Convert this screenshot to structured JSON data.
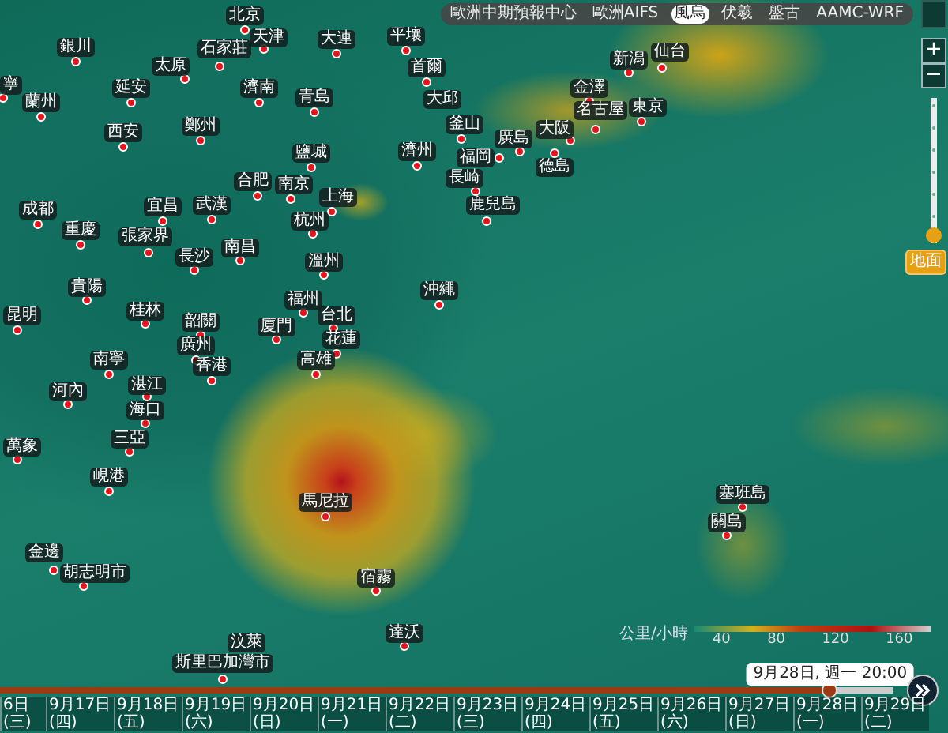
{
  "model_tabs": [
    {
      "label": "歐洲中期預報中心",
      "selected": false
    },
    {
      "label": "歐洲AIFS",
      "selected": false
    },
    {
      "label": "風烏",
      "selected": true
    },
    {
      "label": "伏羲",
      "selected": false
    },
    {
      "label": "盤古",
      "selected": false
    },
    {
      "label": "AAMC-WRF",
      "selected": false
    }
  ],
  "zoom_buttons": [
    "+",
    "−"
  ],
  "altitude": {
    "level": 0,
    "label": "地面"
  },
  "cities": [
    {
      "name": "北京"
    },
    {
      "name": "銀川"
    },
    {
      "name": "太原"
    },
    {
      "name": "石家莊"
    },
    {
      "name": "天津"
    },
    {
      "name": "大連"
    },
    {
      "name": "平壤"
    },
    {
      "name": "首爾"
    },
    {
      "name": "新潟"
    },
    {
      "name": "仙台"
    },
    {
      "name": "寧"
    },
    {
      "name": "蘭州"
    },
    {
      "name": "延安"
    },
    {
      "name": "濟南"
    },
    {
      "name": "青島"
    },
    {
      "name": "大邱"
    },
    {
      "name": "金澤"
    },
    {
      "name": "名古屋"
    },
    {
      "name": "東京"
    },
    {
      "name": "西安"
    },
    {
      "name": "鄭州"
    },
    {
      "name": "釜山"
    },
    {
      "name": "廣島"
    },
    {
      "name": "大阪"
    },
    {
      "name": "鹽城"
    },
    {
      "name": "濟州"
    },
    {
      "name": "福岡"
    },
    {
      "name": "德島"
    },
    {
      "name": "合肥"
    },
    {
      "name": "南京"
    },
    {
      "name": "長崎"
    },
    {
      "name": "成都"
    },
    {
      "name": "宜昌"
    },
    {
      "name": "武漢"
    },
    {
      "name": "上海"
    },
    {
      "name": "鹿兒島"
    },
    {
      "name": "重慶"
    },
    {
      "name": "張家界"
    },
    {
      "name": "杭州"
    },
    {
      "name": "長沙"
    },
    {
      "name": "南昌"
    },
    {
      "name": "溫州"
    },
    {
      "name": "貴陽"
    },
    {
      "name": "福州"
    },
    {
      "name": "沖繩"
    },
    {
      "name": "昆明"
    },
    {
      "name": "桂林"
    },
    {
      "name": "韶關"
    },
    {
      "name": "廈門"
    },
    {
      "name": "台北"
    },
    {
      "name": "廣州"
    },
    {
      "name": "花蓮"
    },
    {
      "name": "南寧"
    },
    {
      "name": "香港"
    },
    {
      "name": "高雄"
    },
    {
      "name": "河內"
    },
    {
      "name": "湛江"
    },
    {
      "name": "海口"
    },
    {
      "name": "萬象"
    },
    {
      "name": "三亞"
    },
    {
      "name": "峴港"
    },
    {
      "name": "馬尼拉"
    },
    {
      "name": "塞班島"
    },
    {
      "name": "關島"
    },
    {
      "name": "金邊"
    },
    {
      "name": "胡志明市"
    },
    {
      "name": "宿霧"
    },
    {
      "name": "汶萊"
    },
    {
      "name": "達沃"
    },
    {
      "name": "斯里巴加灣市"
    }
  ],
  "legend": {
    "unit": "公里/小時",
    "ticks": [
      "40",
      "80",
      "120",
      "160"
    ]
  },
  "timeline": {
    "level": 0.93,
    "tooltip": "9月28日, 週一 20:00",
    "dates": [
      "6日 (三)",
      "9月17日 (四)",
      "9月18日 (五)",
      "9月19日 (六)",
      "9月20日 (日)",
      "9月21日 (一)",
      "9月22日 (二)",
      "9月23日 (三)",
      "9月24日 (四)",
      "9月25日 (五)",
      "9月26日 (六)",
      "9月27日 (日)",
      "9月28日 (一)",
      "9月29日 (二)"
    ]
  }
}
